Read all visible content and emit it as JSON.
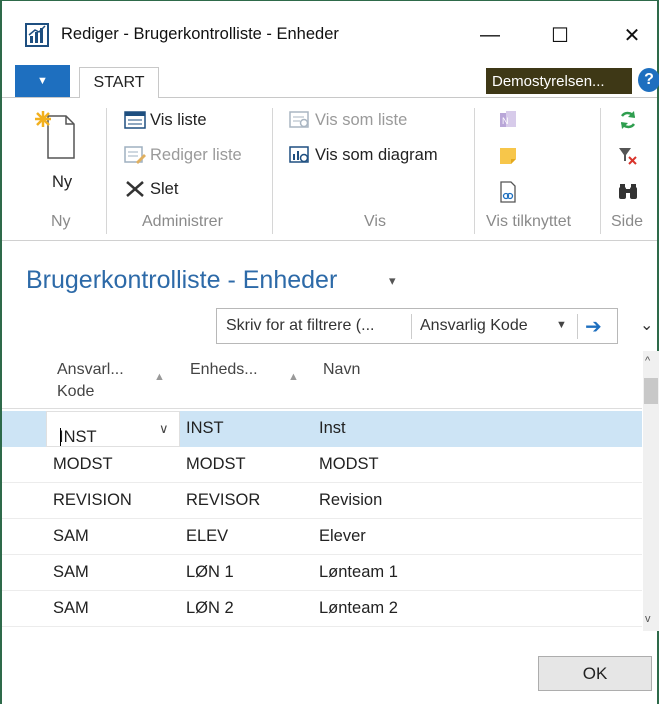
{
  "window": {
    "title": "Rediger - Brugerkontrolliste - Enheder",
    "minimize": "—",
    "maximize": "☐",
    "close": "✕"
  },
  "ribbon": {
    "file_tab": "▼",
    "start_tab": "START",
    "company": "Demostyrelsen...",
    "help": "?",
    "groups": {
      "ny": {
        "label": "Ny",
        "new_button": "Ny"
      },
      "administrer": {
        "label": "Administrer",
        "vis_liste": "Vis liste",
        "rediger_liste": "Rediger liste",
        "slet": "Slet"
      },
      "vis": {
        "label": "Vis",
        "vis_som_liste": "Vis som liste",
        "vis_som_diagram": "Vis som diagram"
      },
      "vis_tilknyttet": {
        "label": "Vis tilknyttet"
      },
      "side": {
        "label": "Side"
      }
    }
  },
  "page": {
    "title": "Brugerkontrolliste - Enheder",
    "filter": {
      "placeholder": "Skriv for at filtrere (...",
      "field": "Ansvarlig Kode"
    }
  },
  "grid": {
    "columns": [
      {
        "line1": "Ansvarl...",
        "line2": "Kode"
      },
      {
        "line1": "Enheds...",
        "line2": ""
      },
      {
        "line1": "Navn",
        "line2": ""
      }
    ],
    "rows": [
      {
        "ansvarlig": "INST",
        "enhed": "INST",
        "navn": "Inst"
      },
      {
        "ansvarlig": "MODST",
        "enhed": "MODST",
        "navn": "MODST"
      },
      {
        "ansvarlig": "REVISION",
        "enhed": "REVISOR",
        "navn": "Revision"
      },
      {
        "ansvarlig": "SAM",
        "enhed": "ELEV",
        "navn": "Elever"
      },
      {
        "ansvarlig": "SAM",
        "enhed": "LØN 1",
        "navn": "Lønteam 1"
      },
      {
        "ansvarlig": "SAM",
        "enhed": "LØN 2",
        "navn": "Lønteam 2"
      }
    ]
  },
  "footer": {
    "ok": "OK"
  },
  "colors": {
    "accent": "#1e6fbf",
    "title_blue": "#2d6aa8",
    "company_bg": "#3e3816",
    "selected_row": "#cde4f5",
    "window_border": "#2e6a4a"
  }
}
